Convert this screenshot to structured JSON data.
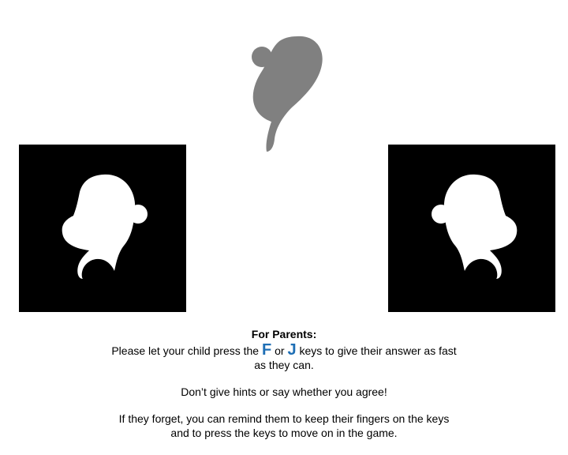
{
  "colors": {
    "target_shape": "#808080",
    "panel_background": "#000000",
    "panel_shape": "#ffffff",
    "key_highlight": "#1f6fb5"
  },
  "stimuli": {
    "target_icon": "gray-ghost-blob-icon",
    "left_icon": "white-ghost-blob-icon",
    "right_icon": "white-ghost-blob-mirrored-icon"
  },
  "instructions": {
    "heading": "For Parents:",
    "line1_before": "Please let your child press the ",
    "key_f": "F",
    "line1_middle": " or ",
    "key_j": "J",
    "line1_after": " keys to give their answer as fast as they can.",
    "paragraph2": "Don’t give hints or say whether you agree!",
    "paragraph3": "If they forget, you can remind them to keep their fingers on the keys and to press the keys to move on in the game."
  }
}
